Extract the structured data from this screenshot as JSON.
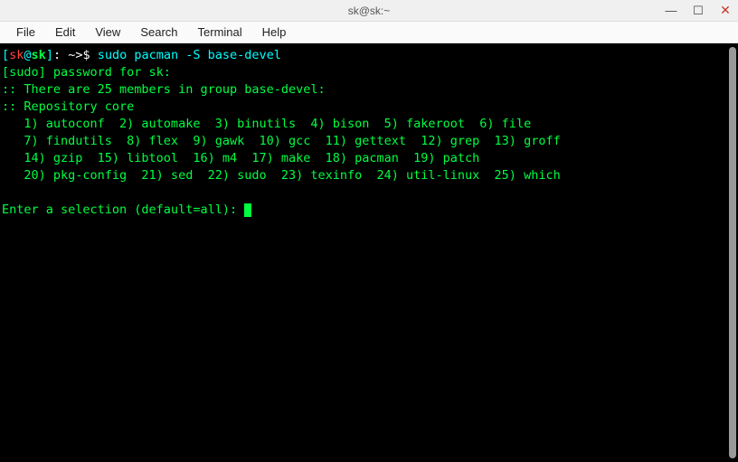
{
  "window": {
    "title": "sk@sk:~",
    "min": "—",
    "max": "☐",
    "close": "✕"
  },
  "menu": {
    "file": "File",
    "edit": "Edit",
    "view": "View",
    "search": "Search",
    "terminal": "Terminal",
    "help": "Help"
  },
  "prompt": {
    "lbr": "[",
    "user": "sk",
    "at": "@",
    "host": "sk",
    "rbr": "]",
    "path": ": ~>$ ",
    "cmd": "sudo pacman -S base-devel"
  },
  "lines": {
    "sudo": "[sudo] password for sk:",
    "members": ":: There are 25 members in group base-devel:",
    "repo": ":: Repository core",
    "pkg1": "   1) autoconf  2) automake  3) binutils  4) bison  5) fakeroot  6) file",
    "pkg2": "   7) findutils  8) flex  9) gawk  10) gcc  11) gettext  12) grep  13) groff",
    "pkg3": "   14) gzip  15) libtool  16) m4  17) make  18) pacman  19) patch",
    "pkg4": "   20) pkg-config  21) sed  22) sudo  23) texinfo  24) util-linux  25) which",
    "selection": "Enter a selection (default=all): "
  }
}
